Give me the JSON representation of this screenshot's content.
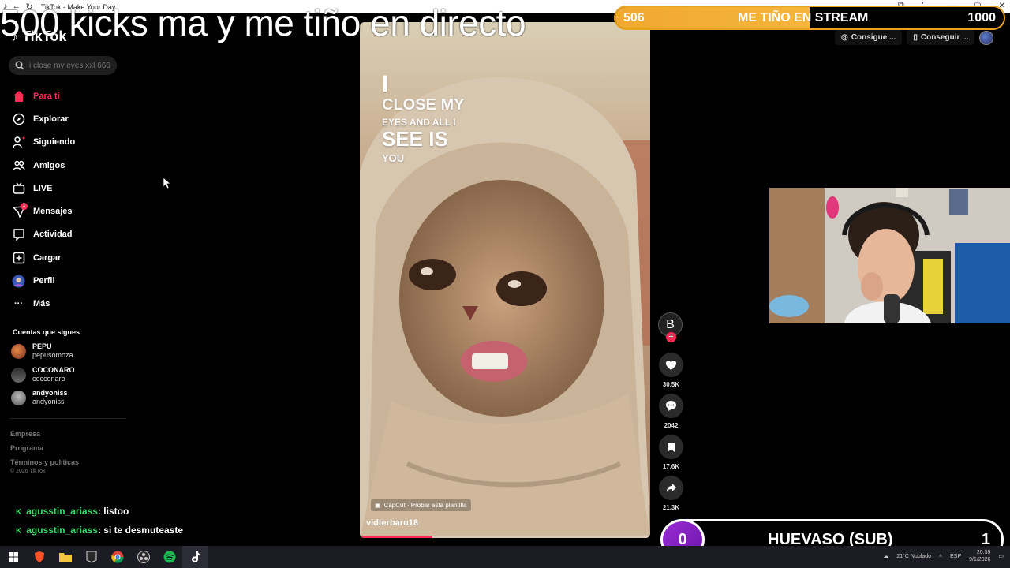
{
  "browser": {
    "tab_title": "TikTok - Make Your Day"
  },
  "overlay": {
    "headline": "500 kicks ma y me tiño en directo",
    "goal": {
      "current": "506",
      "label": "ME TIÑO EN STREAM",
      "target": "1000",
      "progress": 0.5
    },
    "sub_goal": {
      "count": "0",
      "label": "HUEVASO (SUB)",
      "target": "1"
    }
  },
  "tiktok": {
    "logo": "TikTok",
    "search": {
      "placeholder": "i close my eyes xxl 666"
    },
    "top_actions": [
      "Consigue ...",
      "Conseguir ..."
    ],
    "nav": [
      {
        "label": "Para ti",
        "icon": "home-icon",
        "active": true
      },
      {
        "label": "Explorar",
        "icon": "compass-icon"
      },
      {
        "label": "Siguiendo",
        "icon": "following-icon"
      },
      {
        "label": "Amigos",
        "icon": "friends-icon"
      },
      {
        "label": "LIVE",
        "icon": "live-icon"
      },
      {
        "label": "Mensajes",
        "icon": "messages-icon",
        "badge": "1"
      },
      {
        "label": "Actividad",
        "icon": "activity-icon"
      },
      {
        "label": "Cargar",
        "icon": "upload-icon"
      },
      {
        "label": "Perfil",
        "icon": "profile-avatar"
      },
      {
        "label": "Más",
        "icon": "more-icon"
      }
    ],
    "following_title": "Cuentas que sigues",
    "following": [
      {
        "name": "PEPU",
        "handle": "pepusomoza",
        "color": "#d9643a"
      },
      {
        "name": "COCONARO",
        "handle": "cocconaro",
        "color": "#555555"
      },
      {
        "name": "andyoniss",
        "handle": "andyoniss",
        "color": "#8a8a8a"
      }
    ],
    "footer_links": [
      "Empresa",
      "Programa",
      "Términos y políticas"
    ],
    "copyright": "© 2026 TikTok",
    "video": {
      "caption_lines": [
        "I",
        "CLOSE MY",
        "EYES AND ALL I",
        "SEE IS",
        "YOU"
      ],
      "capcut": "CapCut · Probar esta plantilla",
      "username": "vidterbaru18",
      "progress": 0.25
    },
    "actions": {
      "avatar_letter": "B",
      "likes": "30.5K",
      "comments": "2042",
      "saves": "17.6K",
      "shares": "21.3K"
    }
  },
  "chat": [
    {
      "user": "agusstin_ariass",
      "message": ": listoo"
    },
    {
      "user": "agusstin_ariass",
      "message": ": si te desmuteaste"
    }
  ],
  "taskbar": {
    "weather": "21°C  Nublado",
    "lang": "ESP",
    "time": "20:59",
    "date": "9/1/2026"
  }
}
